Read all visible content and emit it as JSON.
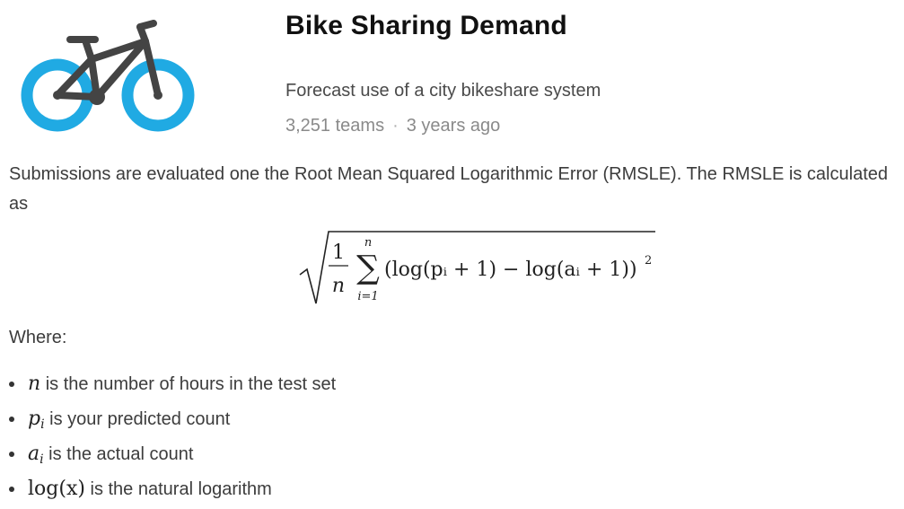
{
  "competition": {
    "title": "Bike Sharing Demand",
    "subtitle": "Forecast use of a city bikeshare system",
    "teams": "3,251 teams",
    "separator": "·",
    "age": "3 years ago",
    "logo_icon": "bicycle-icon",
    "logo_colors": {
      "wheels": "#20aae3",
      "frame": "#444444"
    }
  },
  "evaluation": {
    "intro": "Submissions are evaluated one the Root Mean Squared Logarithmic Error (RMSLE). The RMSLE is calculated as",
    "formula": {
      "numerator": "1",
      "denominator": "n",
      "sum_upper": "n",
      "sum_lower": "i=1",
      "sum_symbol": "∑",
      "body": "(log(pᵢ + 1) − log(aᵢ + 1))",
      "exponent": "2"
    },
    "where_label": "Where:",
    "definitions": [
      {
        "symbol": "n",
        "sub": "",
        "text": "is the number of hours in the test set"
      },
      {
        "symbol": "p",
        "sub": "i",
        "text": "is your predicted count"
      },
      {
        "symbol": "a",
        "sub": "i",
        "text": "is the actual count"
      },
      {
        "symbol": "log(x)",
        "sub": "",
        "text": "is the natural logarithm"
      }
    ]
  }
}
